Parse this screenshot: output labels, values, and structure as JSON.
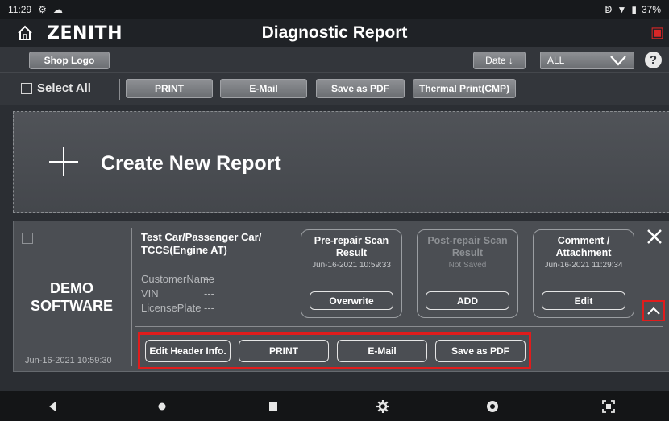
{
  "status_bar": {
    "time": "11:29",
    "battery": "37%"
  },
  "header": {
    "brand": "ZENITH",
    "title": "Diagnostic Report"
  },
  "toolbar": {
    "shop_logo_label": "Shop Logo",
    "date_sort_label": "Date ↓",
    "filter_selected": "ALL",
    "help_label": "?",
    "select_all_label": "Select All",
    "print_label": "PRINT",
    "email_label": "E-Mail",
    "pdf_label": "Save as PDF",
    "thermal_label": "Thermal Print(CMP)"
  },
  "create_report": {
    "label": "Create New Report"
  },
  "report": {
    "source_line1": "DEMO",
    "source_line2": "SOFTWARE",
    "created": "Jun-16-2021 10:59:30",
    "vehicle_line1": "Test Car/Passenger Car/",
    "vehicle_line2": "TCCS(Engine AT)",
    "fields": [
      {
        "label": "CustomerName",
        "value": "---"
      },
      {
        "label": "VIN",
        "value": "---"
      },
      {
        "label": "LicensePlate",
        "value": "---"
      }
    ],
    "pre_scan": {
      "title_line1": "Pre-repair Scan",
      "title_line2": "Result",
      "date": "Jun-16-2021 10:59:33",
      "button": "Overwrite"
    },
    "post_scan": {
      "title_line1": "Post-repair Scan",
      "title_line2": "Result",
      "date": "Not Saved",
      "button": "ADD"
    },
    "comment": {
      "title_line1": "Comment /",
      "title_line2": "Attachment",
      "date": "Jun-16-2021 11:29:34",
      "button": "Edit"
    },
    "actions": {
      "edit_header": "Edit Header Info.",
      "print": "PRINT",
      "email": "E-Mail",
      "pdf": "Save as PDF"
    }
  },
  "colors": {
    "highlight": "#e01c1c",
    "panel": "#4b4e53",
    "toolbar": "#33363b"
  }
}
